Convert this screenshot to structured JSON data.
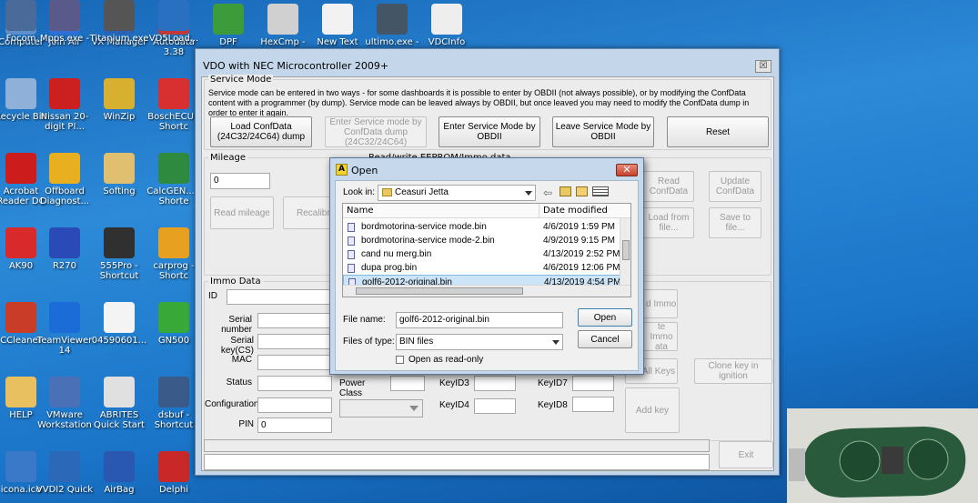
{
  "desktop_icons": [
    {
      "name": "computer",
      "label": "Computer",
      "color": "#5f8fc8"
    },
    {
      "name": "join-air",
      "label": "Join Air",
      "color": "#2f6fd8"
    },
    {
      "name": "vx-manager",
      "label": "VX Manager",
      "color": "#2a62b8"
    },
    {
      "name": "autodata",
      "label": "Autodata 3.38",
      "color": "#c43838"
    },
    {
      "name": "dpf-remover",
      "label": "DPF Remover",
      "color": "#3c9c3c"
    },
    {
      "name": "hexcmp",
      "label": "HexCmp -",
      "color": "#d0d0d0"
    },
    {
      "name": "new-text",
      "label": "New Text",
      "color": "#f2f2f2"
    },
    {
      "name": "ultimo",
      "label": "ultimo.exe -",
      "color": "#445566"
    },
    {
      "name": "vdcinfo",
      "label": "VDCInfo",
      "color": "#eeeeee"
    },
    {
      "name": "recycle-bin",
      "label": "Recycle Bin",
      "color": "#8fb0d8"
    },
    {
      "name": "nissan",
      "label": "Nissan 20-digit PI...",
      "color": "#cc2020"
    },
    {
      "name": "winzip",
      "label": "WinZip",
      "color": "#d8b030"
    },
    {
      "name": "bosch",
      "label": "BoschECU - Shortc",
      "color": "#d83030"
    },
    {
      "name": "acrobat",
      "label": "Acrobat Reader DC",
      "color": "#cc1c1c"
    },
    {
      "name": "offboard",
      "label": "Offboard Diagnost...",
      "color": "#e8b020"
    },
    {
      "name": "softing",
      "label": "Softing",
      "color": "#e0c070"
    },
    {
      "name": "calcgen",
      "label": "CalcGEN... - Shorte",
      "color": "#2e8a3e"
    },
    {
      "name": "ews-ak90",
      "label": "AK90",
      "color": "#d82a2a"
    },
    {
      "name": "r270",
      "label": "R270",
      "color": "#2a4ab8"
    },
    {
      "name": "555pro",
      "label": "555Pro - Shortcut",
      "color": "#303030"
    },
    {
      "name": "carprog",
      "label": "carprog - Shortc",
      "color": "#e8a020"
    },
    {
      "name": "ccleaner",
      "label": "CCleaner",
      "color": "#c83c28"
    },
    {
      "name": "teamviewer",
      "label": "TeamViewer 14",
      "color": "#1c6cd8"
    },
    {
      "name": "doc-04590",
      "label": "04590601...",
      "color": "#f4f4f4"
    },
    {
      "name": "gn500",
      "label": "GN500",
      "color": "#38a838"
    },
    {
      "name": "help",
      "label": "HELP",
      "color": "#e8c060"
    },
    {
      "name": "vmware",
      "label": "VMware Workstation",
      "color": "#4a70b8"
    },
    {
      "name": "abrites",
      "label": "ABRITES Quick Start",
      "color": "#e0e0e0"
    },
    {
      "name": "dsbuf",
      "label": "dsbuf - Shortcut",
      "color": "#3a5a8a"
    },
    {
      "name": "iconaico",
      "label": "icona.ico",
      "color": "#3a78c8"
    },
    {
      "name": "vvdi2-quick",
      "label": "VVDI2 Quick",
      "color": "#2c68b8"
    },
    {
      "name": "airbag",
      "label": "AirBag",
      "color": "#2a58b0"
    },
    {
      "name": "delphi",
      "label": "Delphi",
      "color": "#c82828"
    },
    {
      "name": "focom",
      "label": "Focom",
      "color": "#4a6a9a"
    },
    {
      "name": "mpps",
      "label": "Mpps.exe -",
      "color": "#5a5a8a"
    },
    {
      "name": "titanium",
      "label": "Titanium.exe",
      "color": "#555555"
    },
    {
      "name": "vd5load",
      "label": "VD5Load...",
      "color": "#2a70c0"
    }
  ],
  "main_window": {
    "title": "VDO with NEC Microcontroller 2009+",
    "close": "☒",
    "service_mode": {
      "label": "Service Mode",
      "note": "Service mode can be entered in two ways - for some dashboards it is possible to enter by OBDII (not always possible), or by modifying the ConfData content with a programmer (by dump). Service mode can be leaved always by OBDII, but once leaved you may need to modify the ConfData dump in order to enter it again.",
      "load_confdata": "Load ConfData (24C32/24C64) dump",
      "enter_by_confdata": "Enter Service mode by ConfData dump (24C32/24C64)",
      "enter_by_obdii": "Enter Service Mode by OBDII",
      "leave_by_obdii": "Leave Service Mode by OBDII",
      "reset": "Reset"
    },
    "mileage": {
      "label": "Mileage",
      "value": "0",
      "read": "Read mileage",
      "recalibrate": "Recalibra"
    },
    "eeprom": {
      "label": "Read/write EEPROM/Immo data",
      "read_confdata": "Read ConfData",
      "update_confdata": "Update ConfData",
      "load_from_file": "Load from file...",
      "save_to_file": "Save to file..."
    },
    "immo": {
      "label": "Immo Data",
      "id": "ID",
      "serial_number": "Serial number",
      "serial_key": "Serial key(CS)",
      "mac": "MAC",
      "status": "Status",
      "configuration": "Configuration",
      "pin": "PIN",
      "pin_value": "0",
      "power_class": "Power Class",
      "keyid3": "KeyID3",
      "keyid4": "KeyID4",
      "keyid7": "KeyID7",
      "keyid8": "KeyID8",
      "read_immo": "d Immo",
      "write_immo": "te Immo ata",
      "all_keys": "All Keys",
      "clone_key": "Clone key in ignition",
      "add_key": "Add key"
    },
    "exit": "Exit"
  },
  "open_dialog": {
    "title": "Open",
    "look_in_label": "Look in:",
    "look_in_value": "Ceasuri Jetta",
    "col_name": "Name",
    "col_date": "Date modified",
    "files": [
      {
        "name": "bordmotorina-service mode.bin",
        "date": "4/6/2019 1:59 PM"
      },
      {
        "name": "bordmotorina-service mode-2.bin",
        "date": "4/9/2019 9:15 PM"
      },
      {
        "name": "cand nu merg.bin",
        "date": "4/13/2019 2:52 PM"
      },
      {
        "name": "dupa prog.bin",
        "date": "4/6/2019 12:06 PM"
      },
      {
        "name": "golf6-2012-original.bin",
        "date": "4/13/2019 4:54 PM"
      }
    ],
    "file_name_label": "File name:",
    "file_name_value": "golf6-2012-original.bin",
    "file_type_label": "Files of type:",
    "file_type_value": "BIN files",
    "read_only": "Open as read-only",
    "open": "Open",
    "cancel": "Cancel"
  }
}
